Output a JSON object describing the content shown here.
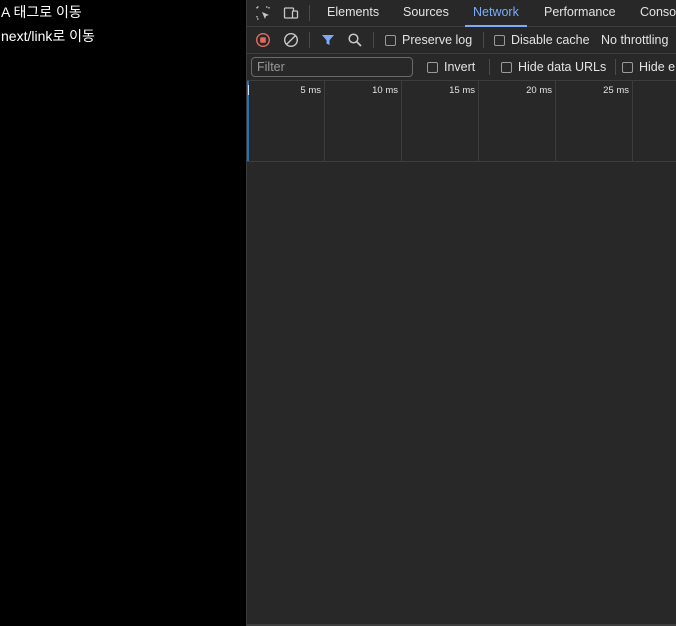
{
  "page": {
    "links": [
      "A 태그로 이동",
      "next/link로 이동"
    ]
  },
  "devtools": {
    "tabs": [
      {
        "label": "Elements"
      },
      {
        "label": "Sources"
      },
      {
        "label": "Network",
        "active": true
      },
      {
        "label": "Performance"
      },
      {
        "label": "Conso"
      }
    ],
    "toolbar": {
      "preserve_log": "Preserve log",
      "disable_cache": "Disable cache",
      "throttling": "No throttling"
    },
    "filter_bar": {
      "placeholder": "Filter",
      "invert": "Invert",
      "hide_data_urls": "Hide data URLs",
      "hide_ext": "Hide e"
    },
    "timeline": {
      "ticks": [
        "5 ms",
        "10 ms",
        "15 ms",
        "20 ms",
        "25 ms"
      ]
    },
    "colors": {
      "record_stop": "#e46962",
      "accent": "#7cacf8",
      "background": "#282828"
    }
  }
}
